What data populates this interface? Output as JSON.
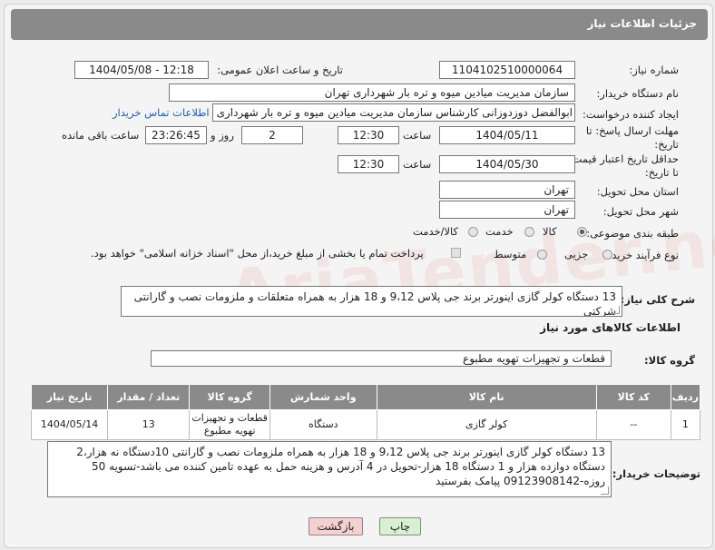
{
  "header": {
    "title": "جزئیات اطلاعات نیاز"
  },
  "fields": {
    "need_number_label": "شماره نیاز:",
    "need_number": "1104102510000064",
    "announce_label": "تاریخ و ساعت اعلان عمومی:",
    "announce_value": "1404/05/08 - 12:18",
    "buyer_label": "نام دستگاه خریدار:",
    "buyer": "سازمان مدیریت میادین میوه و تره بار شهرداری تهران",
    "creator_label": "ایجاد کننده درخواست:",
    "creator": "ابوالفضل دوزدوزانی کارشناس سازمان مدیریت میادین میوه و تره بار شهرداری تهران",
    "contact_link": "اطلاعات تماس خریدار",
    "deadline_label": "مهلت ارسال پاسخ: تا",
    "deadline_label2": "تاریخ:",
    "deadline_date": "1404/05/11",
    "time_label": "ساعت",
    "deadline_time": "12:30",
    "days": "2",
    "days_label": "روز و",
    "remaining": "23:26:45",
    "remaining_label": "ساعت باقی مانده",
    "validity_label": "حداقل تاریخ اعتبار قیمت:",
    "validity_label2": "تا تاریخ:",
    "validity_date": "1404/05/30",
    "validity_time": "12:30",
    "province_label": "استان محل تحویل:",
    "province": "تهران",
    "city_label": "شهر محل تحویل:",
    "city": "تهران",
    "category_label": "طبقه بندی موضوعی:",
    "category_options": [
      "کالا",
      "خدمت",
      "کالا/خدمت"
    ],
    "process_label": "نوع فرآیند خرید :",
    "process_options": [
      "جزیی",
      "متوسط"
    ],
    "payment_note": "پرداخت تمام یا بخشی از مبلغ خرید،از محل \"اسناد خزانه اسلامی\" خواهد بود.",
    "summary_label": "شرح کلی نیاز:",
    "summary": "13 دستگاه کولر گازی اینورتر برند جی پلاس 9،12 و 18 هزار به همراه متعلقات و ملزومات نصب و گارانتی شرکتی",
    "goods_info_title": "اطلاعات کالاهای مورد نیاز",
    "goods_group_label": "گروه کالا:",
    "goods_group": "قطعات و تجهیزات تهویه مطبوع",
    "buyer_notes_label": "توضیحات خریدار:",
    "buyer_notes": "13 دستگاه کولر گازی اینورتر برند جی پلاس 9،12 و 18 هزار به همراه ملزومات نصب و گارانتی 10دستگاه نه هزار،2 دستگاه دوازده هزار و 1 دستگاه 18 هزار-تحویل در 4 آدرس و هزینه حمل به عهده تامین کننده می باشد-تسویه 50 روزه-09123908142 پیامک بفرستید"
  },
  "table": {
    "headers": [
      "ردیف",
      "کد کالا",
      "نام کالا",
      "واحد شمارش",
      "گروه کالا",
      "تعداد / مقدار",
      "تاریخ نیاز"
    ],
    "rows": [
      [
        "1",
        "--",
        "کولر گازی",
        "دستگاه",
        "قطعات و تجهیزات تهویه مطبوع",
        "13",
        "1404/05/14"
      ]
    ]
  },
  "buttons": {
    "print": "چاپ",
    "back": "بازگشت"
  },
  "watermark": "AriaTender.net",
  "colors": {
    "header_bg": "#8a8a8a",
    "link": "#1a5fb4",
    "back_btn": "#f6d0d0",
    "print_btn": "#d6f0d0"
  }
}
